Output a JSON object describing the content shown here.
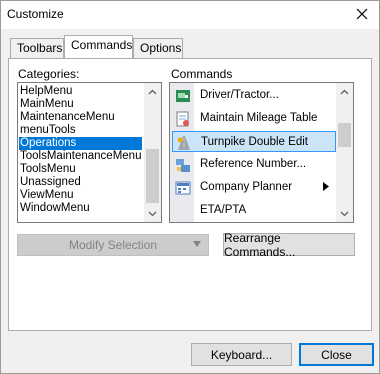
{
  "window": {
    "title": "Customize"
  },
  "tabs": [
    {
      "label": "Toolbars",
      "active": false
    },
    {
      "label": "Commands",
      "active": true
    },
    {
      "label": "Options",
      "active": false
    }
  ],
  "categories": {
    "label": "Categories:",
    "items": [
      "HelpMenu",
      "MainMenu",
      "MaintenanceMenu",
      "menuTools",
      "Operations",
      "ToolsMaintenanceMenu",
      "ToolsMenu",
      "Unassigned",
      "ViewMenu",
      "WindowMenu"
    ],
    "selected": "Operations"
  },
  "commands": {
    "label": "Commands",
    "items": [
      {
        "label": "Driver/Tractor...",
        "icon": "truck-icon"
      },
      {
        "label": "Maintain Mileage Table",
        "icon": "table-icon"
      },
      {
        "label": "Turnpike Double Edit",
        "icon": "road-icon",
        "selected": true
      },
      {
        "label": "Reference Number...",
        "icon": "reference-icon"
      },
      {
        "label": "Company Planner",
        "icon": "planner-icon",
        "submenu": true
      },
      {
        "label": "ETA/PTA",
        "icon": "clock-icon"
      }
    ]
  },
  "buttons": {
    "modify_selection": "Modify Selection",
    "rearrange_commands": "Rearrange Commands...",
    "keyboard": "Keyboard...",
    "close": "Close"
  }
}
